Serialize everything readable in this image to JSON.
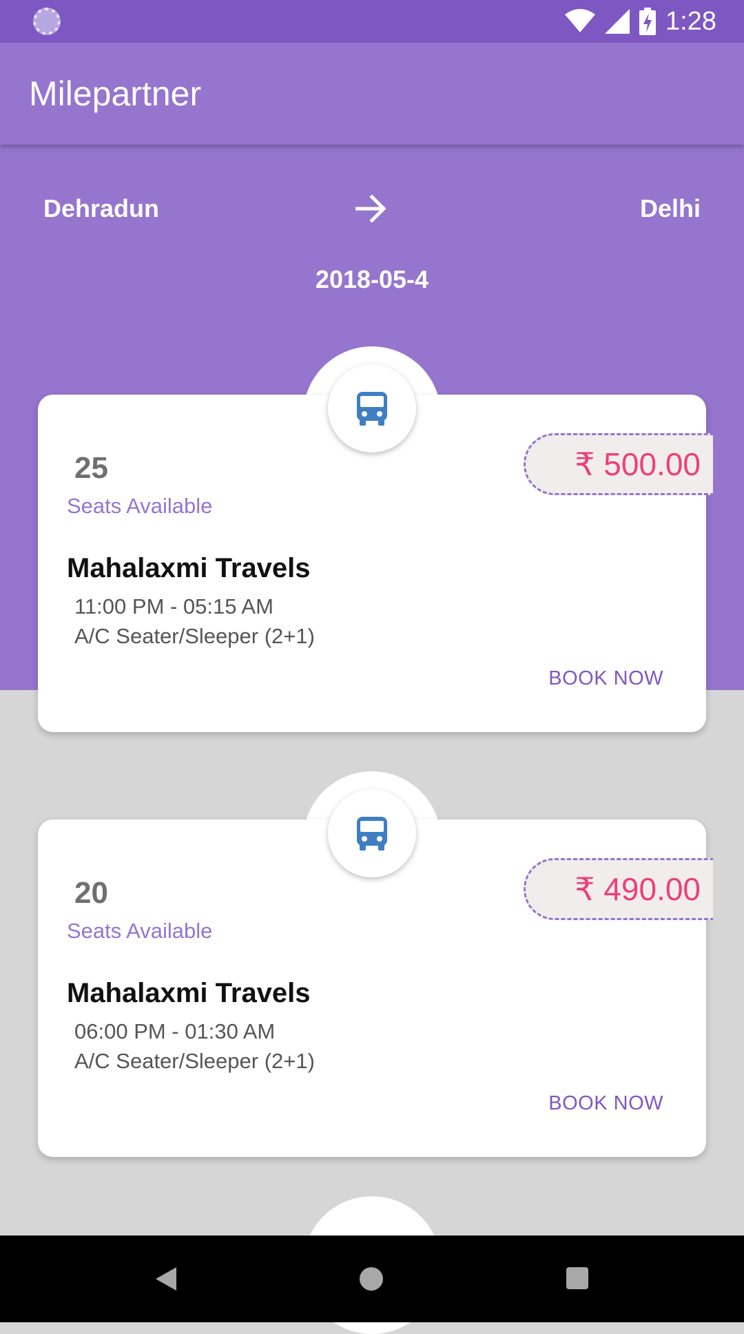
{
  "status_bar": {
    "time": "1:28"
  },
  "app_bar": {
    "title": "Milepartner"
  },
  "route": {
    "from": "Dehradun",
    "to": "Delhi",
    "date": "2018-05-4"
  },
  "colors": {
    "primary": "#9575cd",
    "primary_dark": "#7e57c2",
    "price": "#ec407a",
    "bus_icon": "#3f7ec1"
  },
  "results": [
    {
      "seats": "25",
      "seats_label": "Seats Available",
      "price": "₹ 500.00",
      "operator": "Mahalaxmi Travels",
      "timing": "11:00 PM - 05:15 AM",
      "bus_type": "A/C Seater/Sleeper (2+1)",
      "action": "BOOK NOW"
    },
    {
      "seats": "20",
      "seats_label": "Seats Available",
      "price": "₹ 490.00",
      "operator": "Mahalaxmi Travels",
      "timing": "06:00 PM - 01:30 AM",
      "bus_type": "A/C Seater/Sleeper (2+1)",
      "action": "BOOK NOW"
    }
  ],
  "icons": {
    "status_left": "loader-icon",
    "wifi": "wifi-icon",
    "signal": "signal-icon",
    "battery": "battery-charging-icon",
    "arrow": "arrow-right-icon",
    "bus": "bus-icon",
    "nav_back": "back-icon",
    "nav_home": "home-icon",
    "nav_recents": "recents-icon"
  }
}
